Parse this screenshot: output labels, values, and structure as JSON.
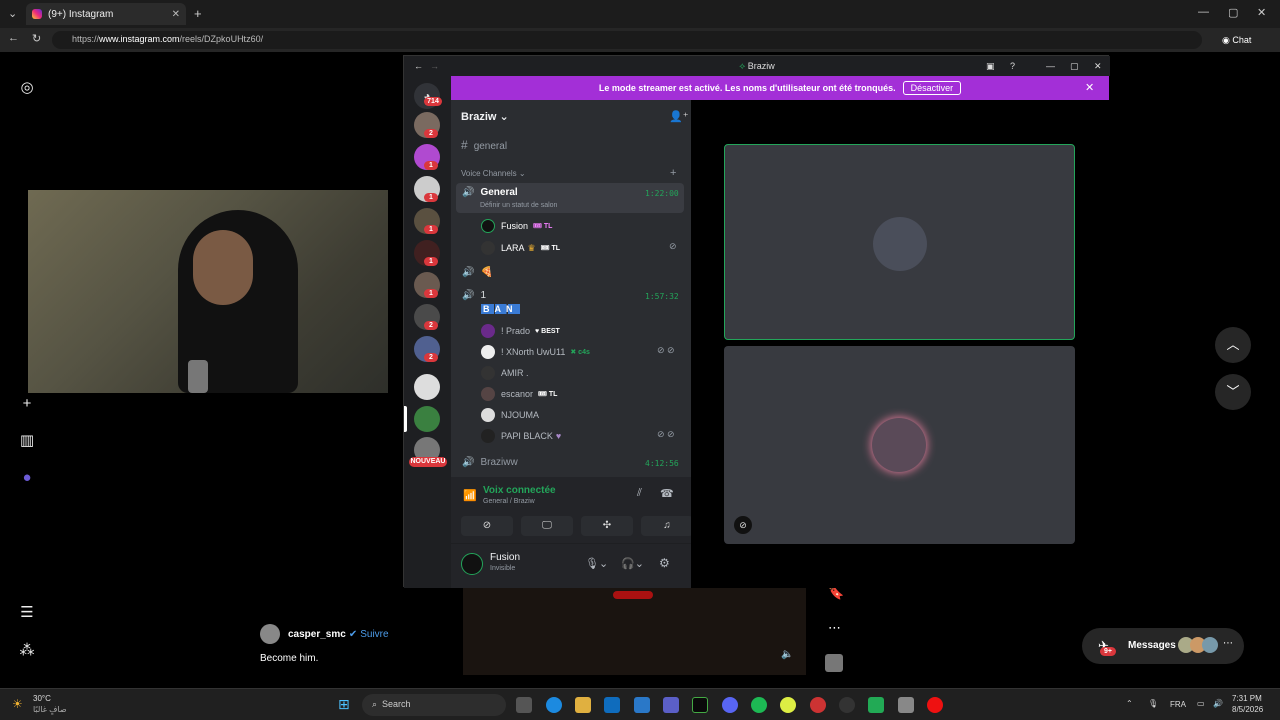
{
  "browser": {
    "tab_title": "(9+) Instagram",
    "url_prefix": "https://",
    "url_host": "www.instagram.com",
    "url_path": "/reels/DZpkoUHtz60/",
    "chat_label": "Chat"
  },
  "discord": {
    "window_title": "Braziw",
    "banner_text": "Le mode streamer est activé. Les noms d'utilisateur ont été tronqués.",
    "banner_button": "Désactiver",
    "server_name": "Braziw",
    "text_channel": "general",
    "voice_header": "Voice Channels",
    "guild_badges": [
      "714",
      "2",
      "1",
      "1",
      "1",
      "1",
      "1",
      "2",
      "2"
    ],
    "new_label": "NOUVEAU",
    "channels": [
      {
        "name": "General",
        "timer": "1:22:00",
        "status": "Définir un statut de salon"
      },
      {
        "name": "1",
        "timer": "1:57:32",
        "letters": "BAN"
      },
      {
        "name": "Braziww",
        "timer": "4:12:56"
      }
    ],
    "general_users": [
      {
        "name": "Fusion",
        "tag": "TL"
      },
      {
        "name": "LARA",
        "tag": "TL"
      }
    ],
    "channel1_users": [
      {
        "name": "! Prado",
        "tag": "BEST"
      },
      {
        "name": "! XNorth UwU11",
        "tag": "c4s"
      },
      {
        "name": "AMIR .",
        "tag": ""
      },
      {
        "name": "escanor",
        "tag": "TL"
      },
      {
        "name": "NJOUMA",
        "tag": ""
      },
      {
        "name": "PAPI BLACK",
        "tag": ""
      }
    ],
    "voice_status": "Voix connectée",
    "voice_location": "General / Braziw",
    "me_name": "Fusion",
    "me_status": "Invisible"
  },
  "instagram": {
    "username": "casper_smc",
    "follow": "Suivre",
    "caption": "Become him.",
    "messages_label": "Messages",
    "messages_badge": "9+"
  },
  "taskbar": {
    "weather_temp": "30°C",
    "weather_desc": "صافٍ غالبًا",
    "search_placeholder": "Search",
    "lang": "FRA",
    "time": "7:31 PM",
    "date": "8/5/2026"
  }
}
